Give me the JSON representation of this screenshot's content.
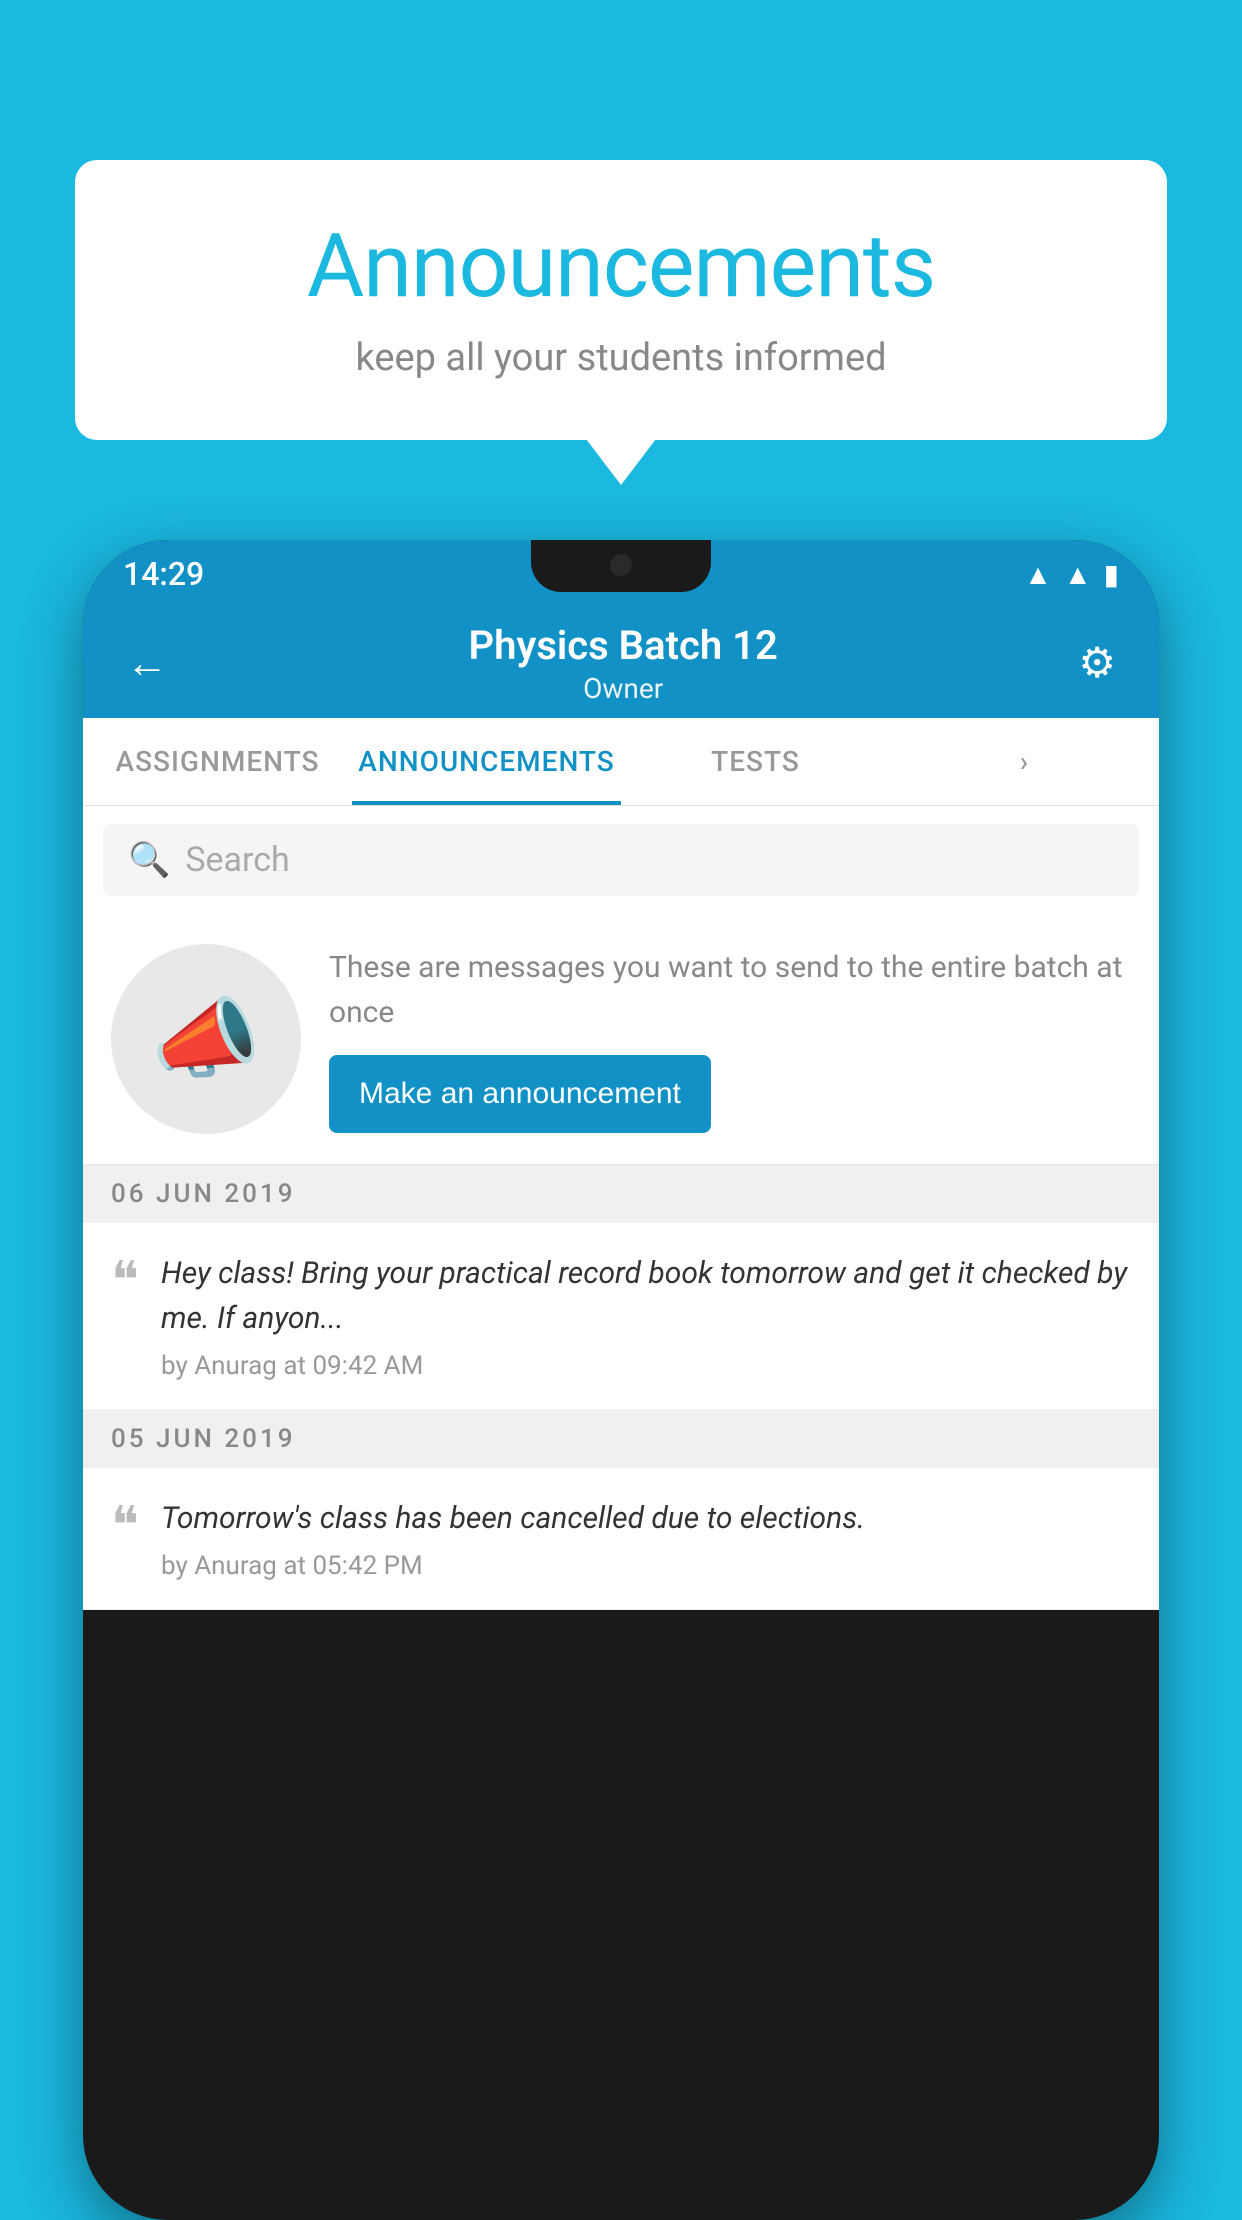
{
  "background_color": "#1BB8E0",
  "speech_bubble": {
    "title": "Announcements",
    "subtitle": "keep all your students informed"
  },
  "phone": {
    "status_bar": {
      "time": "14:29",
      "wifi_icon": "wifi",
      "signal_icon": "signal",
      "battery_icon": "battery"
    },
    "header": {
      "title": "Physics Batch 12",
      "subtitle": "Owner",
      "back_label": "←",
      "settings_label": "⚙"
    },
    "tabs": [
      {
        "label": "ASSIGNMENTS",
        "active": false
      },
      {
        "label": "ANNOUNCEMENTS",
        "active": true
      },
      {
        "label": "TESTS",
        "active": false
      },
      {
        "label": "›",
        "active": false
      }
    ],
    "search": {
      "placeholder": "Search"
    },
    "announcement_prompt": {
      "description": "These are messages you want to send to the entire batch at once",
      "button_label": "Make an announcement"
    },
    "date_groups": [
      {
        "date": "06  JUN  2019",
        "items": [
          {
            "text": "Hey class! Bring your practical record book tomorrow and get it checked by me. If anyon...",
            "meta": "by Anurag at 09:42 AM"
          }
        ]
      },
      {
        "date": "05  JUN  2019",
        "items": [
          {
            "text": "Tomorrow's class has been cancelled due to elections.",
            "meta": "by Anurag at 05:42 PM"
          }
        ]
      }
    ]
  }
}
